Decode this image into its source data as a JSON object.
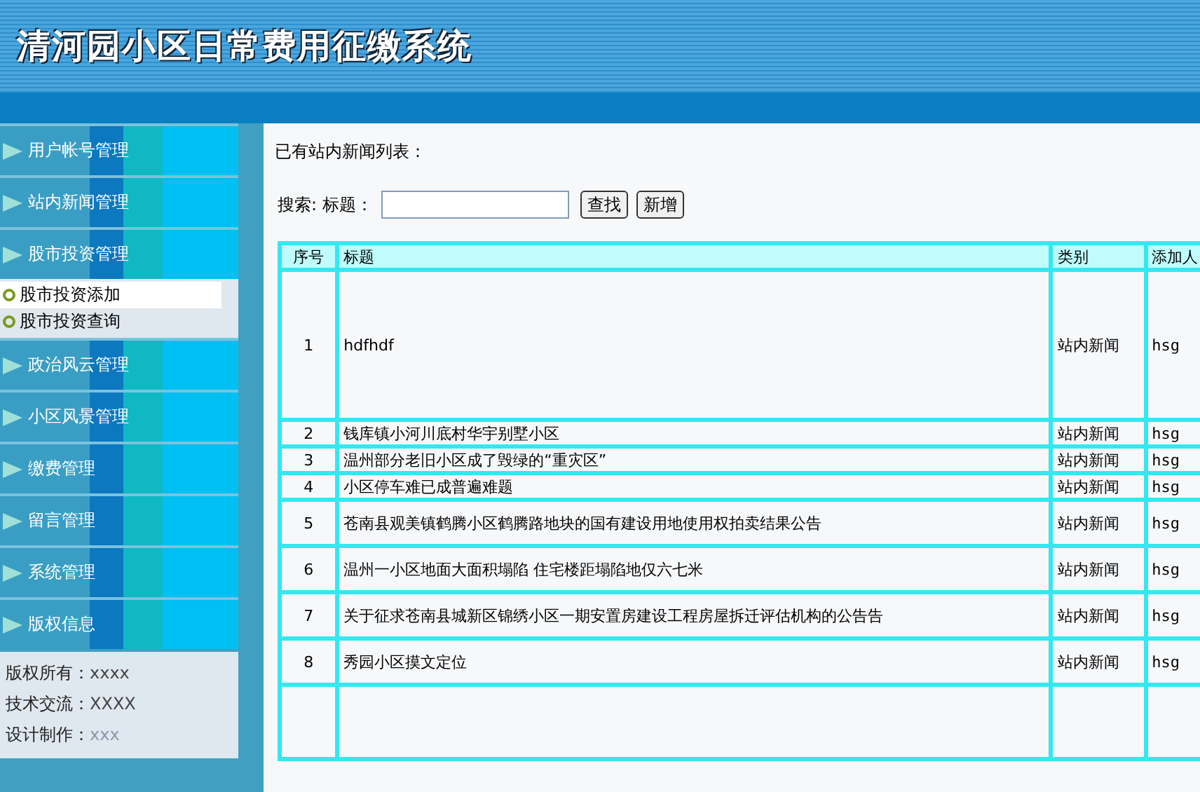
{
  "header": {
    "title": "清河园小区日常费用征缴系统"
  },
  "sidebar": {
    "items": [
      {
        "label": "用户帐号管理"
      },
      {
        "label": "站内新闻管理"
      },
      {
        "label": "股市投资管理",
        "children": [
          {
            "label": "股市投资添加",
            "selected": true
          },
          {
            "label": "股市投资查询",
            "selected": false
          }
        ]
      },
      {
        "label": "政治风云管理"
      },
      {
        "label": "小区风景管理"
      },
      {
        "label": "缴费管理"
      },
      {
        "label": "留言管理"
      },
      {
        "label": "系统管理"
      },
      {
        "label": "版权信息",
        "info": [
          {
            "label": "版权所有：",
            "value": "xxxx"
          },
          {
            "label": "技术交流：",
            "value": "XXXX"
          },
          {
            "label": "设计制作：",
            "value": "xxx"
          }
        ]
      }
    ]
  },
  "content": {
    "heading": "已有站内新闻列表：",
    "search": {
      "label": "搜索: 标题：",
      "buttons": [
        "查找",
        "新增"
      ]
    },
    "table": {
      "columns": [
        "序号",
        "标题",
        "类别",
        "添加人"
      ],
      "rows": [
        {
          "cells": [
            "1",
            "hdfhdf",
            "站内新闻",
            "hsg"
          ]
        },
        {
          "cells": [
            "2",
            "钱库镇小河川底村华宇别墅小区",
            "站内新闻",
            "hsg"
          ]
        },
        {
          "cells": [
            "3",
            "温州部分老旧小区成了毁绿的“重灾区”",
            "站内新闻",
            "hsg"
          ]
        },
        {
          "cells": [
            "4",
            "小区停车难已成普遍难题",
            "站内新闻",
            "hsg"
          ]
        },
        {
          "cells": [
            "5",
            "苍南县观美镇鹤腾小区鹤腾路地块的国有建设用地使用权拍卖结果公告",
            "站内新闻",
            "hsg"
          ]
        },
        {
          "cells": [
            "6",
            "温州一小区地面大面积塌陷 住宅楼距塌陷地仅六七米",
            "站内新闻",
            "hsg"
          ]
        },
        {
          "cells": [
            "7",
            "关于征求苍南县城新区锦绣小区一期安置房建设工程房屋拆迁评估机构的公告告",
            "站内新闻",
            "hsg"
          ]
        },
        {
          "cells": [
            "8",
            "秀园小区摸文定位",
            "站内新闻",
            "hsg"
          ]
        }
      ]
    }
  }
}
